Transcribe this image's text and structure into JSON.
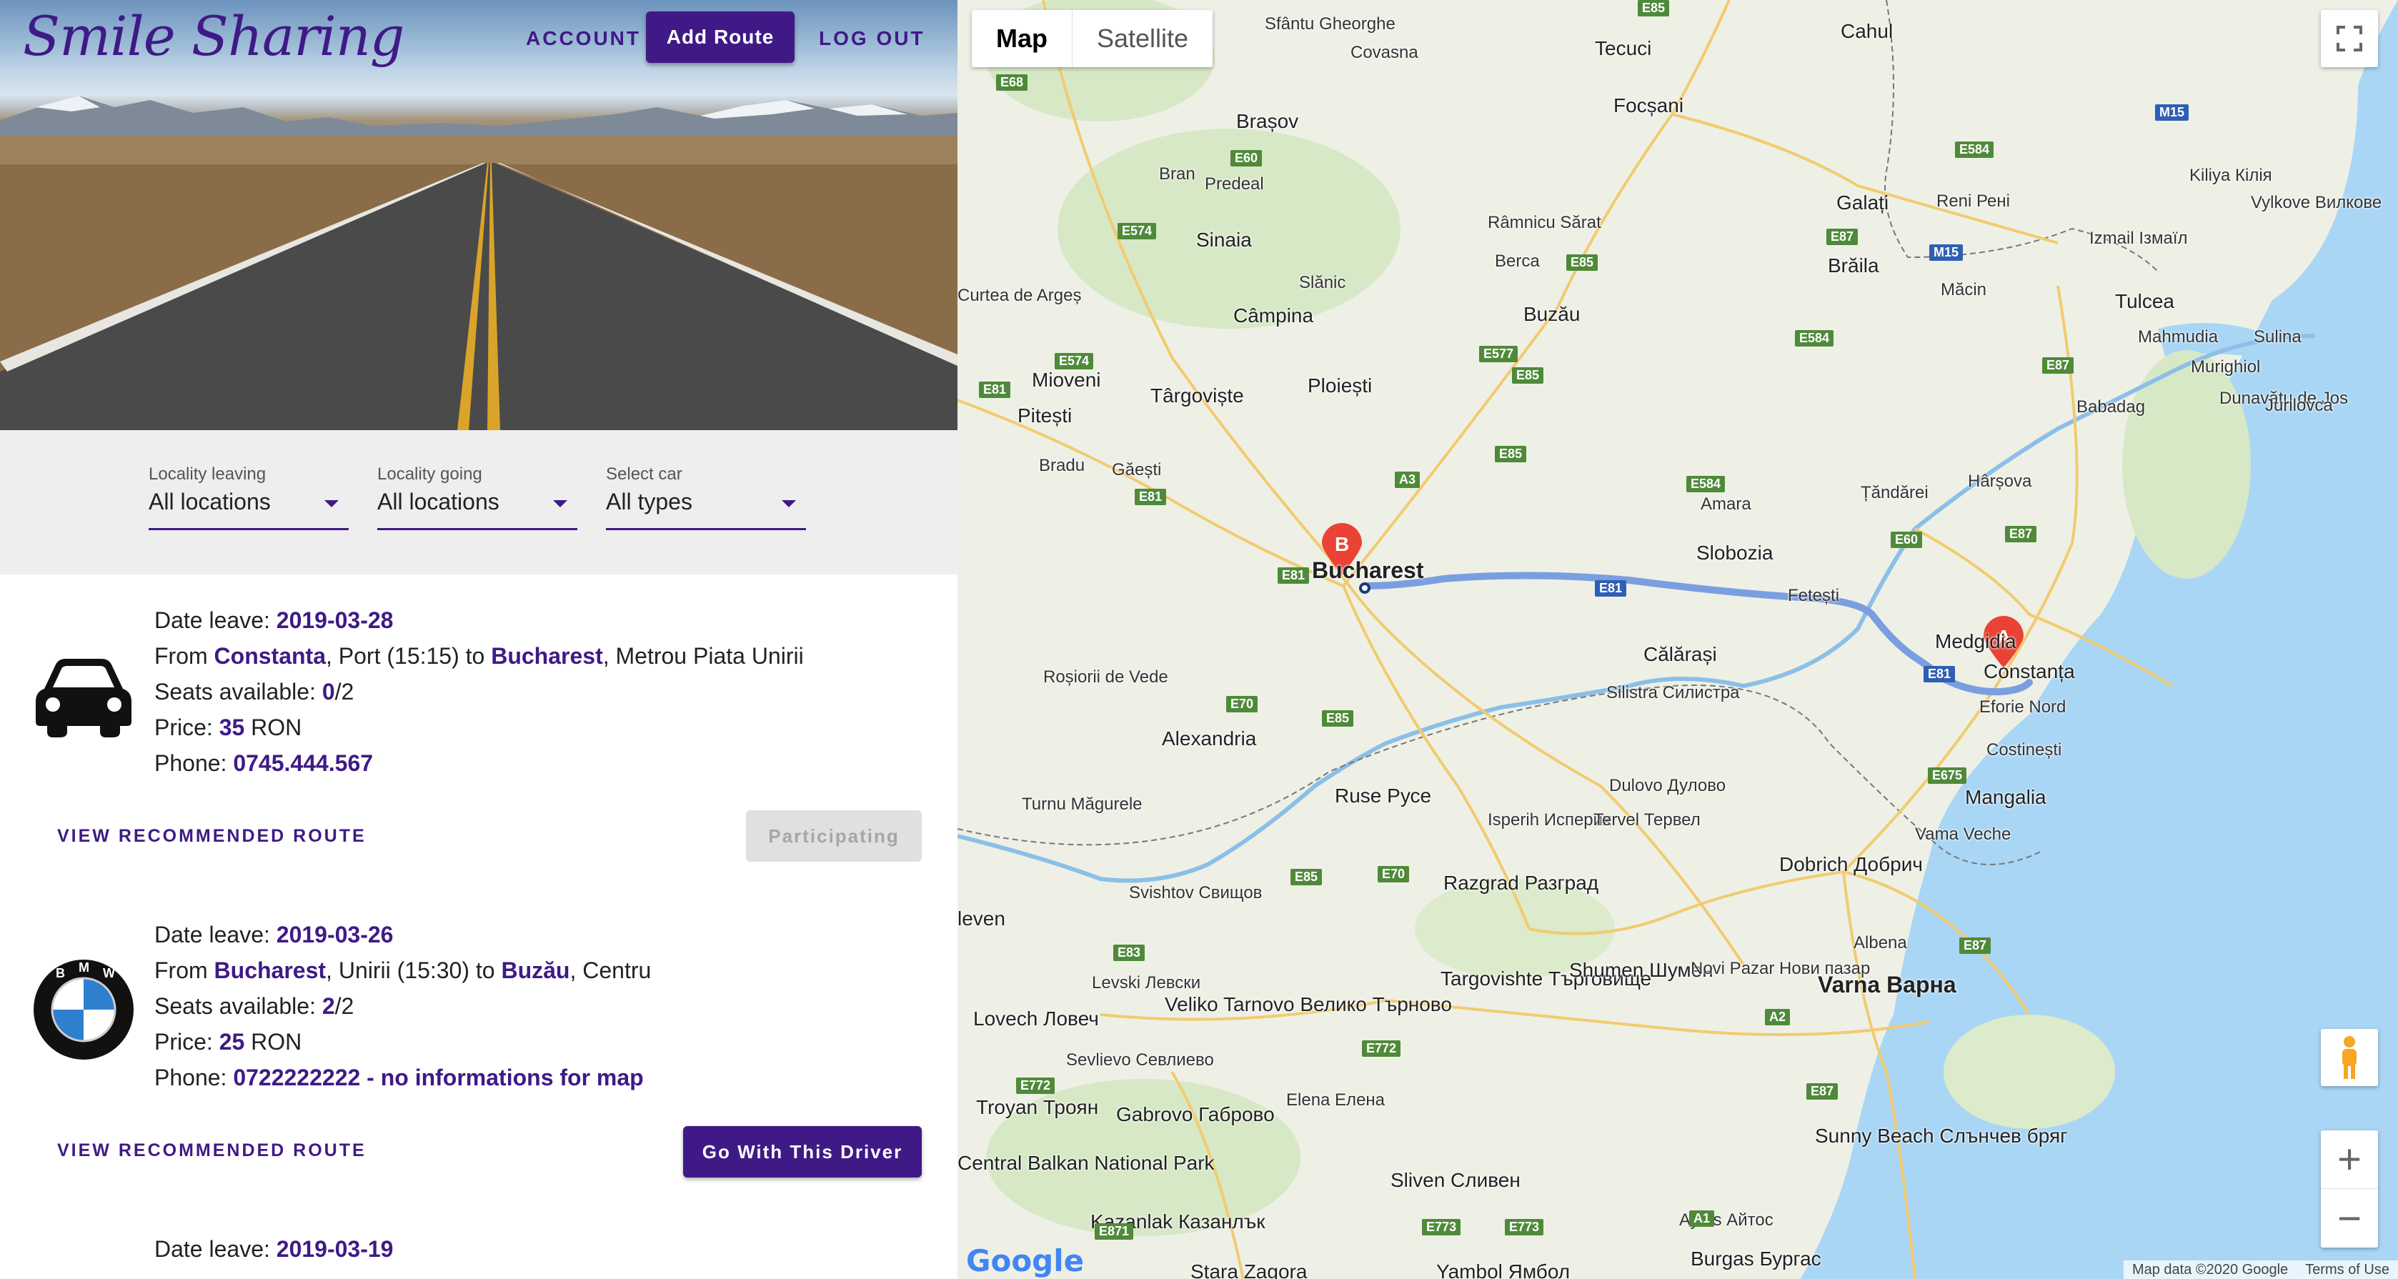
{
  "header": {
    "brand": "Smile Sharing",
    "nav": {
      "account": "ACCOUNT",
      "add_route": "Add Route",
      "logout": "LOG OUT"
    }
  },
  "filters": [
    {
      "label": "Locality leaving",
      "value": "All locations"
    },
    {
      "label": "Locality going",
      "value": "All locations"
    },
    {
      "label": "Select car",
      "value": "All types"
    }
  ],
  "routes": [
    {
      "car_icon": "car-icon",
      "date_label": "Date leave: ",
      "date": "2019-03-28",
      "from_prefix": "From ",
      "from_city": "Constanta",
      "from_detail": ", Port (15:15) to ",
      "to_city": "Bucharest",
      "to_detail": ", Metrou Piata Unirii",
      "seats_label": "Seats available: ",
      "seats_available": "0",
      "seats_total": "/2",
      "price_label": "Price: ",
      "price": "35",
      "currency": " RON",
      "phone_label": "Phone: ",
      "phone": "0745.444.567",
      "view_label": "VIEW RECOMMENDED ROUTE",
      "action_label": "Participating",
      "action_state": "disabled"
    },
    {
      "car_icon": "bmw-logo-icon",
      "date_label": "Date leave: ",
      "date": "2019-03-26",
      "from_prefix": "From ",
      "from_city": "Bucharest",
      "from_detail": ", Unirii (15:30) to ",
      "to_city": "Buzău",
      "to_detail": ", Centru",
      "seats_label": "Seats available: ",
      "seats_available": "2",
      "seats_total": "/2",
      "price_label": "Price: ",
      "price": "25",
      "currency": " RON",
      "phone_label": "Phone: ",
      "phone": "0722222222 - no informations for map",
      "view_label": "VIEW RECOMMENDED ROUTE",
      "action_label": "Go With This Driver",
      "action_state": "enabled"
    },
    {
      "date_label": "Date leave: ",
      "date": "2019-03-19"
    }
  ],
  "map": {
    "type_tabs": [
      "Map",
      "Satellite"
    ],
    "selected_tab": "Map",
    "markers": [
      "A",
      "B"
    ],
    "route_color": "#7a9fe0",
    "places": {
      "sfantu": "Sfântu Gheorghe",
      "covasna": "Covasna",
      "tecuci": "Tecuci",
      "cahul": "Cahul",
      "brasov": "Brașov",
      "focsani": "Focșani",
      "galati": "Galați",
      "reni": "Reni Рені",
      "braila": "Brăila",
      "izmail": "Izmail Ізмаїл",
      "vylkove": "Vylkove Вилкове",
      "kiliya": "Kiliya Кілія",
      "bran": "Bran",
      "predeal": "Predeal",
      "sinaia": "Sinaia",
      "ramnicu": "Râmnicu Sărat",
      "berca": "Berca",
      "buzau": "Buzău",
      "macin": "Măcin",
      "tulcea": "Tulcea",
      "mahmudia": "Mahmudia",
      "sulina": "Sulina",
      "murighiol": "Murighiol",
      "dunavatu": "Dunavățu de Jos",
      "curtea": "Curtea de Argeș",
      "slanic": "Slănic",
      "campina": "Câmpina",
      "mioveni": "Mioveni",
      "targoviste": "Târgoviște",
      "ploiesti": "Ploiești",
      "babadag": "Babadag",
      "jurilovca": "Jurilovca",
      "pitesti": "Pitești",
      "bradu": "Bradu",
      "gaesti": "Găești",
      "tandarei": "Țăndărei",
      "harsova": "Hârșova",
      "amara": "Amara",
      "bucharest": "Bucharest",
      "slobozia": "Slobozia",
      "fetesti": "Fetești",
      "medgidia": "Medgidia",
      "constanta": "Constanța",
      "eforie": "Eforie Nord",
      "rosiorii": "Roșiorii de Vede",
      "calarasi": "Călărași",
      "silistra": "Silistra Силистра",
      "costinesti": "Costinești",
      "alexandria": "Alexandria",
      "ruse": "Ruse Русе",
      "dulovo": "Dulovo Дулово",
      "mangalia": "Mangalia",
      "vamaveche": "Vama Veche",
      "turnu": "Turnu Măgurele",
      "isperih": "Isperih Исперих",
      "tervel": "Tervel Тервел",
      "svishtov": "Svishtov Свищов",
      "razgrad": "Razgrad Разград",
      "dobrich": "Dobrich Добрич",
      "pleven": "leven",
      "levski": "Levski Левски",
      "targovishte": "Targovishte Търговище",
      "shumen": "Shumen Шумен",
      "novipazar": "Novi Pazar Нови пазар",
      "varna": "Varna Варна",
      "albena": "Albena",
      "lovech": "Lovech Ловеч",
      "veliko": "Veliko Tarnovo Велико Търново",
      "sevlievo": "Sevlievo Севлиево",
      "troyan": "Troyan Троян",
      "gabrovo": "Gabrovo Габрово",
      "elena": "Elena Елена",
      "aytos": "Aytos Айтос",
      "sunnybeach": "Sunny Beach Слънчев бряг",
      "sliven": "Sliven Сливен",
      "kazanlak": "Kazanlak Казанлък",
      "centralbalkan": "Central Balkan National Park",
      "burgas": "Burgas Бургас",
      "stara": "Stara Zagora",
      "yambol": "Yambol Ямбол"
    },
    "roads": {
      "e85a": "E85",
      "e68": "E68",
      "e60a": "E60",
      "e574": "E574",
      "e584a": "E584",
      "e87a": "E87",
      "e85b": "E85",
      "m15a": "M15",
      "m15b": "M15",
      "e577": "E577",
      "e85c": "E85",
      "e584b": "E584",
      "e574b": "E574",
      "e87b": "E87",
      "e81a": "E81",
      "e81b": "E81",
      "a3": "A3",
      "e85d": "E85",
      "e584c": "E584",
      "e60b": "E60",
      "e87c": "E87",
      "e81c": "E81",
      "e81d": "E81",
      "e81e": "E81",
      "e70a": "E70",
      "e85e": "E85",
      "e675": "E675",
      "e85f": "E85",
      "e70b": "E70",
      "e83": "E83",
      "e87d": "E87",
      "a2": "A2",
      "e772a": "E772",
      "e772b": "E772",
      "e87e": "E87",
      "e871": "E871",
      "e773a": "E773",
      "e773b": "E773",
      "a1": "A1"
    },
    "zoom_in": "+",
    "zoom_out": "−",
    "attribution": [
      "Map data ©2020 Google",
      "Terms of Use"
    ],
    "logo": "Google"
  }
}
